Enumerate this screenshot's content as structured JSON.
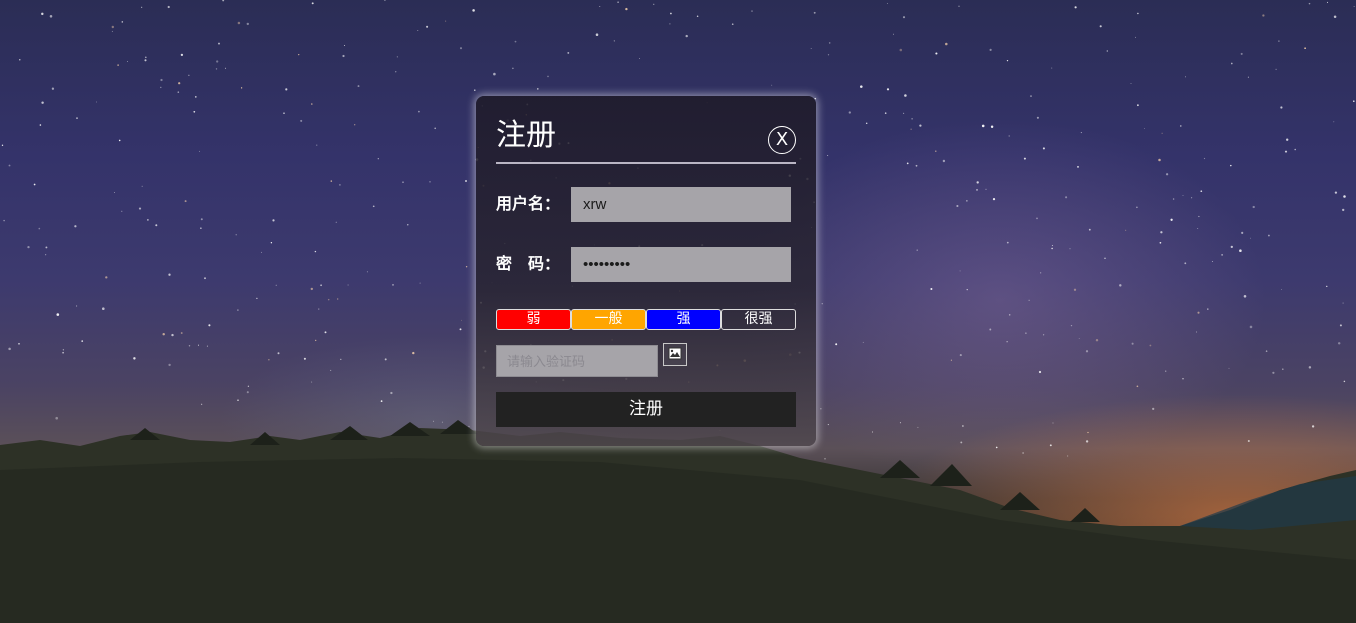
{
  "register": {
    "title": "注册",
    "close_label": "X",
    "username_label": "用户名：",
    "username_value": "xrw",
    "password_label": "密　码：",
    "password_value": "123456789",
    "strength_levels": [
      "弱",
      "一般",
      "强",
      "很强"
    ],
    "captcha_placeholder": "请输入验证码",
    "captcha_image_icon": "broken-image-icon",
    "submit_label": "注册"
  },
  "colors": {
    "weak": "#ff0000",
    "normal": "#ffa500",
    "strong": "#0000ff",
    "submit_bg": "#222222"
  }
}
